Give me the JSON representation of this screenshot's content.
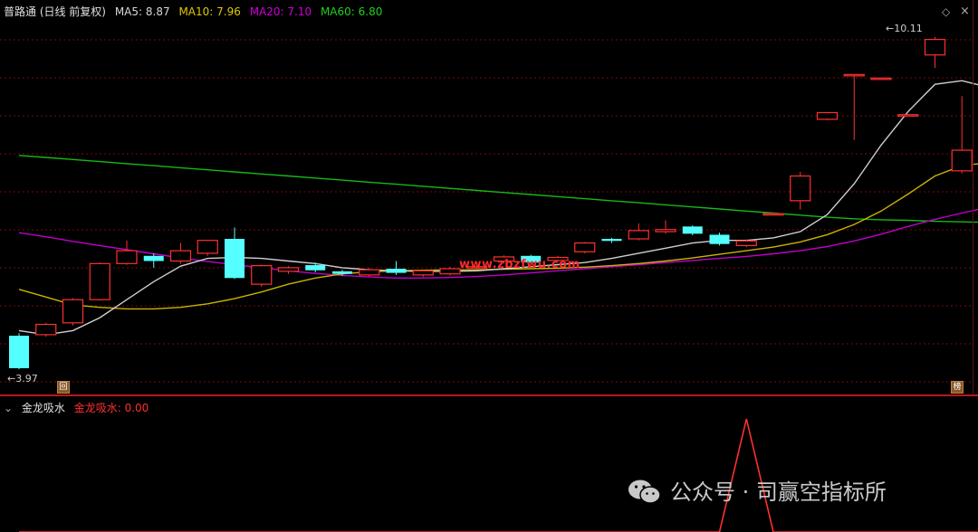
{
  "header": {
    "title": "普路通 (日线 前复权)",
    "ma5_label": "MA5: 8.87",
    "ma10_label": "MA10: 7.96",
    "ma20_label": "MA20: 7.10",
    "ma60_label": "MA60: 6.80"
  },
  "colors": {
    "up": "#ff3030",
    "down": "#54ffff",
    "ma5": "#cfcfcf",
    "ma10": "#c9b300",
    "ma20": "#c000c8",
    "ma60": "#16b816",
    "grid": "#7a0d0d"
  },
  "price": {
    "high_label": "10.11",
    "low_label": "3.97",
    "watermark_site": "www.zbzfwu.com"
  },
  "indicator": {
    "name": "金龙吸水",
    "value_label": "金龙吸水: 0.00"
  },
  "watermark": {
    "text": "公众号 · 司赢空指标所"
  },
  "tags": {
    "bottom_left": "回",
    "bottom_right": "榜"
  },
  "candles": [
    {
      "o": 4.6,
      "c": 3.97,
      "h": 4.65,
      "l": 3.95
    },
    {
      "o": 4.62,
      "c": 4.82,
      "h": 4.85,
      "l": 4.58
    },
    {
      "o": 4.85,
      "c": 5.3,
      "h": 5.33,
      "l": 4.8
    },
    {
      "o": 5.3,
      "c": 6.0,
      "h": 6.02,
      "l": 5.28
    },
    {
      "o": 6.0,
      "c": 6.25,
      "h": 6.45,
      "l": 5.98
    },
    {
      "o": 6.15,
      "c": 6.05,
      "h": 6.2,
      "l": 5.92
    },
    {
      "o": 6.05,
      "c": 6.25,
      "h": 6.4,
      "l": 6.0
    },
    {
      "o": 6.2,
      "c": 6.45,
      "h": 6.46,
      "l": 6.15
    },
    {
      "o": 6.48,
      "c": 5.72,
      "h": 6.7,
      "l": 5.7
    },
    {
      "o": 5.6,
      "c": 5.96,
      "h": 5.98,
      "l": 5.55
    },
    {
      "o": 5.85,
      "c": 5.92,
      "h": 5.95,
      "l": 5.8
    },
    {
      "o": 5.97,
      "c": 5.87,
      "h": 6.02,
      "l": 5.83
    },
    {
      "o": 5.85,
      "c": 5.8,
      "h": 5.88,
      "l": 5.76
    },
    {
      "o": 5.78,
      "c": 5.88,
      "h": 5.92,
      "l": 5.75
    },
    {
      "o": 5.9,
      "c": 5.82,
      "h": 6.05,
      "l": 5.78
    },
    {
      "o": 5.78,
      "c": 5.86,
      "h": 5.89,
      "l": 5.74
    },
    {
      "o": 5.8,
      "c": 5.9,
      "h": 5.94,
      "l": 5.77
    },
    {
      "o": 5.94,
      "c": 5.94,
      "h": 6.02,
      "l": 5.88
    },
    {
      "o": 6.05,
      "c": 6.13,
      "h": 6.16,
      "l": 6.0
    },
    {
      "o": 6.15,
      "c": 6.02,
      "h": 6.17,
      "l": 6.0
    },
    {
      "o": 6.06,
      "c": 6.12,
      "h": 6.15,
      "l": 6.04
    },
    {
      "o": 6.23,
      "c": 6.4,
      "h": 6.42,
      "l": 6.2
    },
    {
      "o": 6.48,
      "c": 6.44,
      "h": 6.5,
      "l": 6.4
    },
    {
      "o": 6.48,
      "c": 6.64,
      "h": 6.78,
      "l": 6.45
    },
    {
      "o": 6.62,
      "c": 6.66,
      "h": 6.84,
      "l": 6.58
    },
    {
      "o": 6.72,
      "c": 6.58,
      "h": 6.74,
      "l": 6.55
    },
    {
      "o": 6.56,
      "c": 6.38,
      "h": 6.6,
      "l": 6.35
    },
    {
      "o": 6.35,
      "c": 6.44,
      "h": 6.47,
      "l": 6.32
    },
    {
      "o": 6.97,
      "c": 6.97,
      "h": 6.97,
      "l": 6.97
    },
    {
      "o": 7.22,
      "c": 7.7,
      "h": 7.78,
      "l": 7.05
    },
    {
      "o": 8.8,
      "c": 8.93,
      "h": 8.94,
      "l": 8.78
    },
    {
      "o": 9.67,
      "c": 9.67,
      "h": 9.67,
      "l": 8.4
    },
    {
      "o": 9.6,
      "c": 9.6,
      "h": 9.6,
      "l": 9.6
    },
    {
      "o": 8.89,
      "c": 8.89,
      "h": 8.89,
      "l": 8.89
    },
    {
      "o": 10.05,
      "c": 10.35,
      "h": 10.4,
      "l": 9.8
    },
    {
      "o": 7.8,
      "c": 8.2,
      "h": 9.25,
      "l": 7.75
    }
  ],
  "ma_series": {
    "ma5": [
      4.7,
      4.62,
      4.7,
      4.95,
      5.3,
      5.65,
      5.95,
      6.1,
      6.12,
      6.1,
      6.05,
      6.0,
      5.92,
      5.88,
      5.86,
      5.85,
      5.85,
      5.86,
      5.9,
      5.94,
      5.98,
      6.02,
      6.1,
      6.2,
      6.3,
      6.4,
      6.45,
      6.45,
      6.5,
      6.62,
      6.95,
      7.55,
      8.3,
      8.95,
      9.48,
      9.55,
      9.42
    ],
    "ma10": [
      5.5,
      5.35,
      5.2,
      5.15,
      5.12,
      5.12,
      5.15,
      5.22,
      5.32,
      5.45,
      5.6,
      5.72,
      5.8,
      5.84,
      5.86,
      5.87,
      5.88,
      5.88,
      5.89,
      5.9,
      5.91,
      5.93,
      5.96,
      6.0,
      6.05,
      6.11,
      6.18,
      6.25,
      6.32,
      6.42,
      6.56,
      6.76,
      7.02,
      7.35,
      7.7,
      7.9,
      7.96
    ],
    "ma20": [
      6.6,
      6.52,
      6.43,
      6.35,
      6.27,
      6.19,
      6.11,
      6.04,
      5.98,
      5.92,
      5.86,
      5.81,
      5.77,
      5.74,
      5.72,
      5.72,
      5.73,
      5.75,
      5.78,
      5.82,
      5.86,
      5.9,
      5.94,
      5.98,
      6.02,
      6.06,
      6.1,
      6.14,
      6.19,
      6.25,
      6.33,
      6.44,
      6.57,
      6.72,
      6.86,
      6.98,
      7.1
    ],
    "ma60": [
      8.1,
      8.06,
      8.02,
      7.98,
      7.94,
      7.9,
      7.86,
      7.82,
      7.78,
      7.74,
      7.7,
      7.66,
      7.62,
      7.58,
      7.54,
      7.5,
      7.46,
      7.42,
      7.38,
      7.34,
      7.3,
      7.26,
      7.22,
      7.18,
      7.14,
      7.1,
      7.06,
      7.02,
      6.98,
      6.94,
      6.9,
      6.87,
      6.85,
      6.84,
      6.82,
      6.81,
      6.8
    ]
  },
  "indicator_series": [
    0,
    0,
    0,
    0,
    0,
    0,
    0,
    0,
    0,
    0,
    0,
    0,
    0,
    0,
    0,
    0,
    0,
    0,
    0,
    0,
    0,
    0,
    0,
    0,
    0,
    0,
    0,
    1,
    0,
    0,
    0,
    0,
    0,
    0,
    0,
    0,
    0
  ]
}
